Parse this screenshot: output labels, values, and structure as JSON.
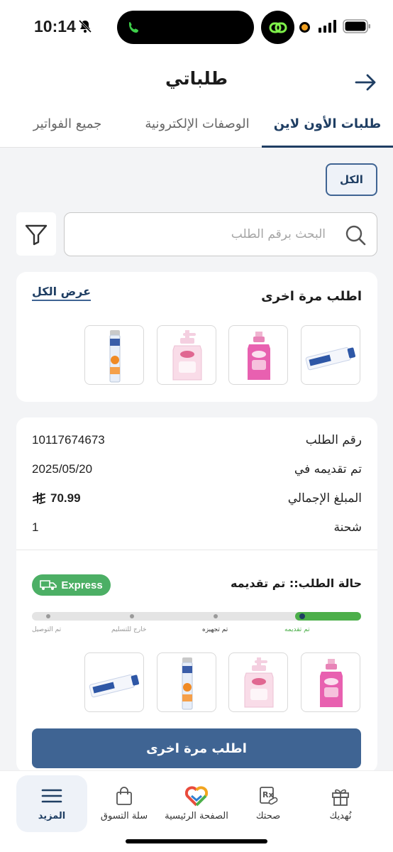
{
  "status_bar": {
    "time": "10:14"
  },
  "header": {
    "title": "طلباتي",
    "tabs": [
      {
        "label": "طلبات الأون لاين",
        "active": true
      },
      {
        "label": "الوصفات الإلكترونية",
        "active": false
      },
      {
        "label": "جميع الفواتير",
        "active": false
      }
    ]
  },
  "filter_chip": {
    "label": "الكل"
  },
  "search": {
    "placeholder": "البحث برقم الطلب"
  },
  "reorder_section": {
    "title": "اطلب مرة اخرى",
    "view_all": "عرض الكل",
    "products": [
      "mustela-cream-tube",
      "johnsons-shampoo-pink",
      "johnsons-lotion-pink",
      "vitamin-effervescent-tube"
    ]
  },
  "order": {
    "rows": [
      {
        "label": "رقم الطلب",
        "value": "10117674673"
      },
      {
        "label": "تم تقديمه في",
        "value": "2025/05/20"
      },
      {
        "label": "المبلغ الإجمالي",
        "value": "70.99"
      },
      {
        "label": "شحنة",
        "value": "1"
      }
    ],
    "status_label": "حالة الطلب:: تم تقديمه",
    "express_label": "Express",
    "progress": 0.2,
    "steps": [
      {
        "label": "تم تقديمه",
        "state": "done"
      },
      {
        "label": "تم تجهيزه",
        "state": "current"
      },
      {
        "label": "خارج للتسليم",
        "state": "pending"
      },
      {
        "label": "تم التوصيل",
        "state": "pending"
      }
    ],
    "products": [
      "johnsons-shampoo-pink",
      "johnsons-lotion-pink",
      "vitamin-effervescent-tube",
      "mustela-cream-tube"
    ],
    "reorder_button": "اطلب مرة اخرى"
  },
  "bottom_nav": [
    {
      "label": "نُهديك",
      "icon": "gift-icon"
    },
    {
      "label": "صحتك",
      "icon": "prescription-icon"
    },
    {
      "label": "الصفحة الرئيسية",
      "icon": "home-logo-icon"
    },
    {
      "label": "سلة التسوق",
      "icon": "bag-icon"
    },
    {
      "label": "المزيد",
      "icon": "menu-icon",
      "active": true
    }
  ],
  "colors": {
    "primary": "#3f6493",
    "primary_dark": "#1f3e63",
    "success": "#4caf4a",
    "express": "#4caf65",
    "background": "#f3f4f6"
  }
}
